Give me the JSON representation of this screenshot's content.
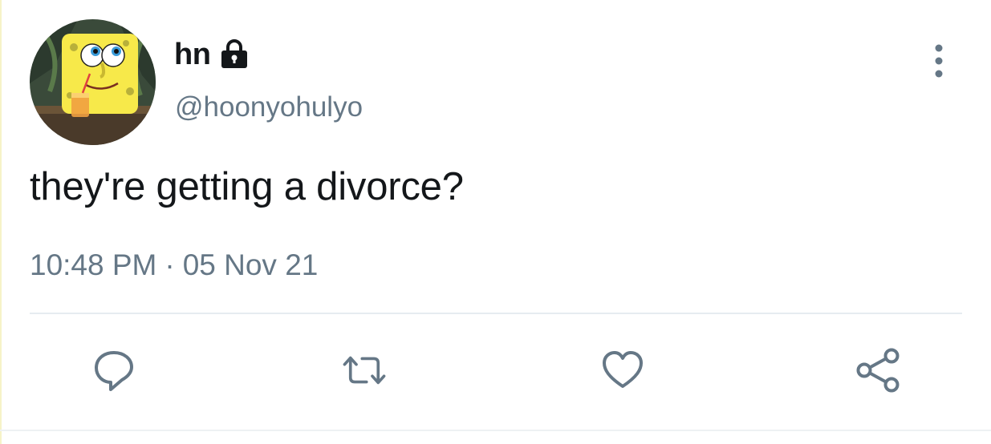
{
  "author": {
    "display_name": "hn",
    "handle": "@hoonyohulyo",
    "protected": true,
    "avatar_icon": "spongebob-avatar"
  },
  "tweet": {
    "text": "they're getting a divorce?",
    "time": "10:48 PM",
    "separator": "·",
    "date": "05 Nov 21"
  },
  "actions": [
    {
      "name": "reply",
      "icon": "reply-icon"
    },
    {
      "name": "retweet",
      "icon": "retweet-icon"
    },
    {
      "name": "like",
      "icon": "heart-icon"
    },
    {
      "name": "share",
      "icon": "share-icon"
    }
  ],
  "colors": {
    "text_primary": "#14171a",
    "text_secondary": "#657786",
    "icon_gray": "#657786",
    "divider": "#e6ecf0"
  }
}
